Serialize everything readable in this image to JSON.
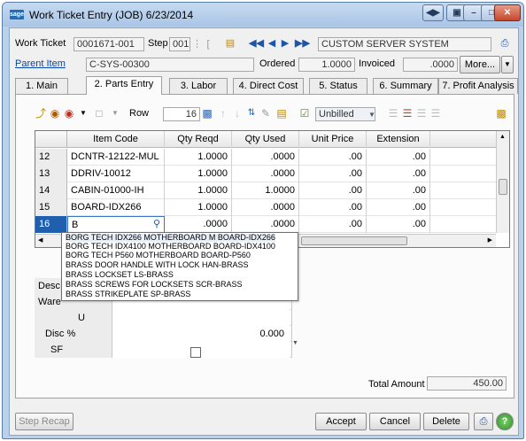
{
  "window": {
    "app_icon_text": "sage",
    "title": "Work Ticket Entry (JOB) 6/23/2014"
  },
  "header": {
    "work_ticket_label": "Work Ticket",
    "work_ticket_value": "0001671-001",
    "step_label": "Step",
    "step_value": "001",
    "customer_name": "CUSTOM SERVER SYSTEM",
    "parent_item_label": "Parent Item",
    "parent_item_value": "C-SYS-00300",
    "ordered_label": "Ordered",
    "ordered_value": "1.0000",
    "invoiced_label": "Invoiced",
    "invoiced_value": ".0000",
    "more_label": "More..."
  },
  "tabs": [
    {
      "label": "1. Main"
    },
    {
      "label": "2. Parts Entry"
    },
    {
      "label": "3. Labor"
    },
    {
      "label": "4. Direct Cost"
    },
    {
      "label": "5. Status"
    },
    {
      "label": "6. Summary"
    },
    {
      "label": "7. Profit Analysis"
    }
  ],
  "toolbar": {
    "row_label": "Row",
    "row_value": "16",
    "unbilled_value": "Unbilled"
  },
  "grid": {
    "columns": [
      "Item Code",
      "Qty Reqd",
      "Qty Used",
      "Unit Price",
      "Extension"
    ],
    "rows": [
      {
        "num": "12",
        "item": "DCNTR-12122-MUL",
        "reqd": "1.0000",
        "used": ".0000",
        "price": ".00",
        "ext": ".00"
      },
      {
        "num": "13",
        "item": "DDRIV-10012",
        "reqd": "1.0000",
        "used": ".0000",
        "price": ".00",
        "ext": ".00"
      },
      {
        "num": "14",
        "item": "CABIN-01000-IH",
        "reqd": "1.0000",
        "used": "1.0000",
        "price": ".00",
        "ext": ".00"
      },
      {
        "num": "15",
        "item": "BOARD-IDX266",
        "reqd": "1.0000",
        "used": ".0000",
        "price": ".00",
        "ext": ".00"
      },
      {
        "num": "16",
        "item": "B",
        "reqd": ".0000",
        "used": ".0000",
        "price": ".00",
        "ext": ".00"
      }
    ]
  },
  "autocomplete": [
    "BORG TECH IDX266 MOTHERBOARD M  BOARD-IDX266",
    "BORG TECH IDX4100 MOTHERBOARD  BOARD-IDX4100",
    "BORG TECH P560 MOTHERBOARD  BOARD-P560",
    "BRASS DOOR HANDLE WITH LOCK  HAN-BRASS",
    "BRASS LOCKSET  LS-BRASS",
    "BRASS SCREWS FOR LOCKSETS  SCR-BRASS",
    "BRASS STRIKEPLATE  SP-BRASS"
  ],
  "detail": {
    "desc_label": "Desc",
    "ware_label": "Ware",
    "u_label": "U",
    "disc_label": "Disc %",
    "disc_value": "0.000",
    "sf_label": "SF"
  },
  "footer": {
    "total_label": "Total Amount",
    "total_value": "450.00",
    "step_recap": "Step Recap",
    "accept": "Accept",
    "cancel": "Cancel",
    "delete": "Delete"
  }
}
